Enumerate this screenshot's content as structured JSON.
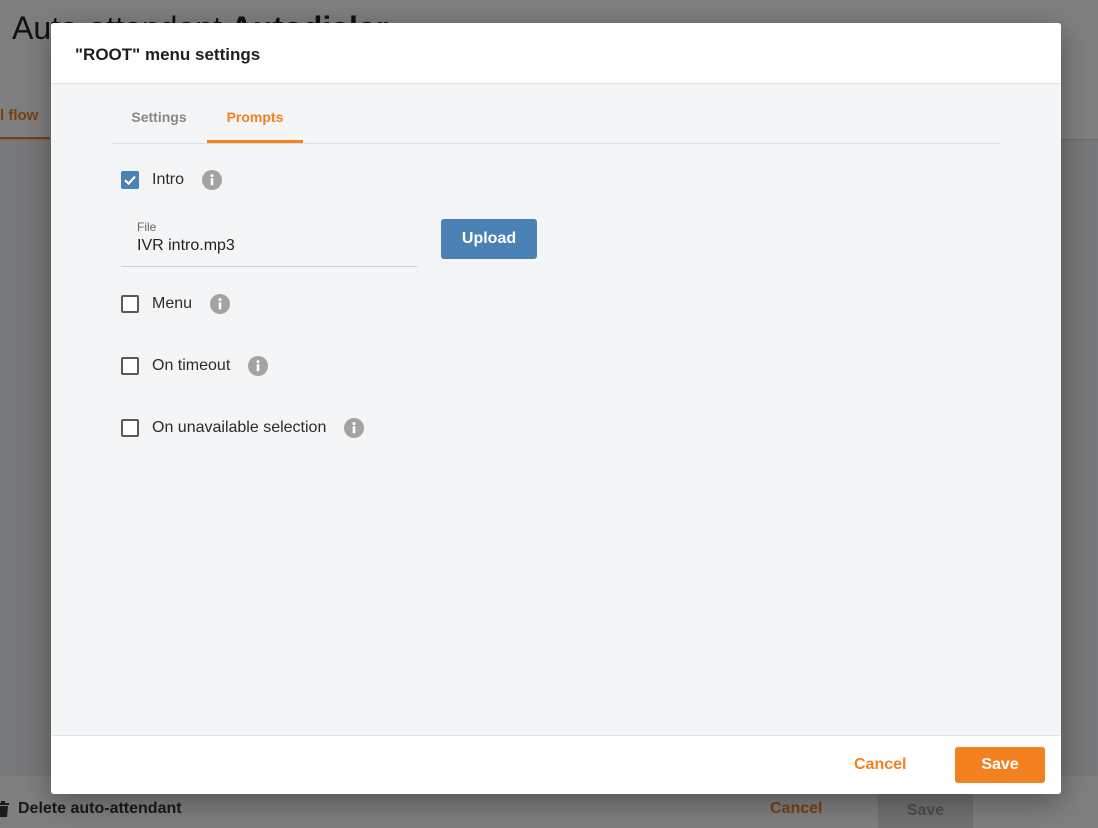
{
  "background": {
    "title_light": "Auto-attendant",
    "title_bold": "Autodialer",
    "active_tab": "l flow",
    "delete_label": "Delete auto-attendant",
    "cancel_label": "Cancel",
    "save_label": "Save"
  },
  "dialog": {
    "title": "\"ROOT\" menu settings",
    "tabs": [
      {
        "label": "Settings",
        "active": false
      },
      {
        "label": "Prompts",
        "active": true
      }
    ],
    "prompts": [
      {
        "label": "Intro",
        "checked": true,
        "icon": "info-icon"
      },
      {
        "label": "Menu",
        "checked": false,
        "icon": "info-icon"
      },
      {
        "label": "On timeout",
        "checked": false,
        "icon": "info-icon"
      },
      {
        "label": "On unavailable selection",
        "checked": false,
        "icon": "info-icon"
      }
    ],
    "file": {
      "label": "File",
      "value": "IVR intro.mp3"
    },
    "upload_label": "Upload",
    "footer": {
      "cancel_label": "Cancel",
      "save_label": "Save"
    }
  },
  "colors": {
    "accent": "#f48120",
    "primary_blue": "#4a82b5",
    "overlay": "rgba(0,0,0,0.5)"
  }
}
